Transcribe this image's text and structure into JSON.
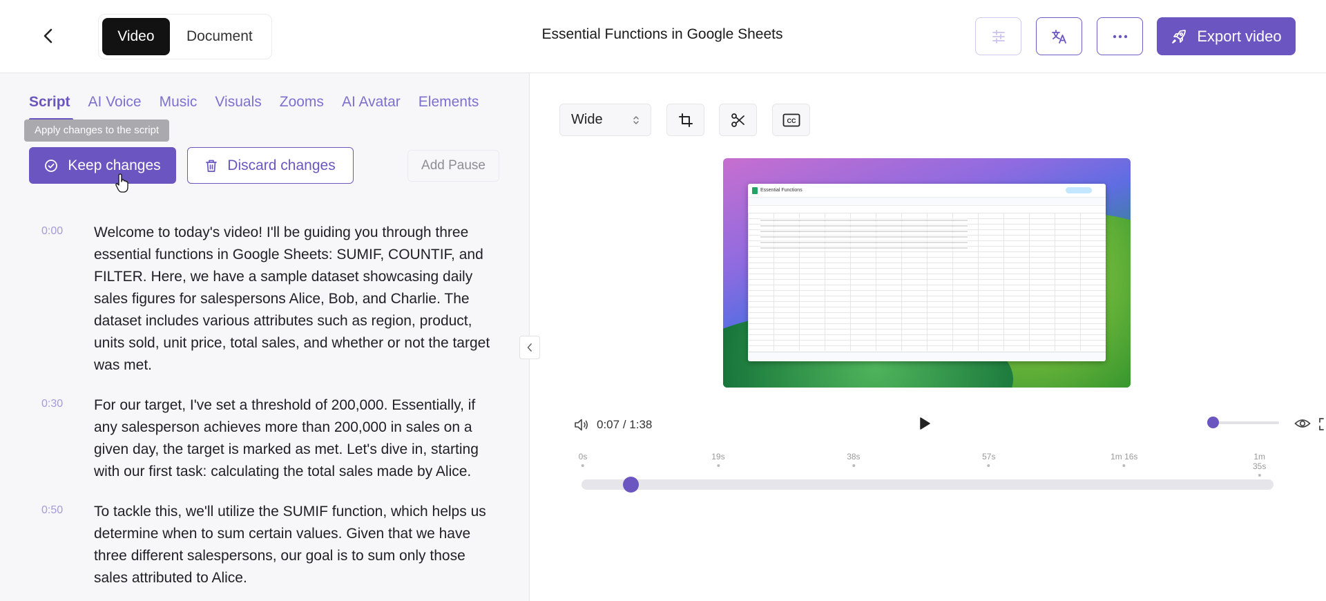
{
  "header": {
    "title": "Essential Functions in Google Sheets",
    "mode_tabs": [
      {
        "label": "Video",
        "active": true
      },
      {
        "label": "Document",
        "active": false
      }
    ],
    "export_label": "Export video",
    "icons": [
      "back-chevron-icon",
      "sliders-icon",
      "translate-icon",
      "more-icon",
      "rocket-icon"
    ]
  },
  "left": {
    "tabs": [
      {
        "label": "Script",
        "active": true
      },
      {
        "label": "AI Voice"
      },
      {
        "label": "Music"
      },
      {
        "label": "Visuals"
      },
      {
        "label": "Zooms"
      },
      {
        "label": "AI Avatar"
      },
      {
        "label": "Elements"
      }
    ],
    "tooltip": "Apply changes to the script",
    "keep_label": "Keep changes",
    "discard_label": "Discard changes",
    "pause_label": "Add Pause",
    "script": [
      {
        "time": "0:00",
        "text": "Welcome to today's video! I'll be guiding you through three essential functions in Google Sheets: SUMIF, COUNTIF, and FILTER. Here, we have a sample dataset showcasing daily sales figures for salespersons Alice, Bob, and Charlie. The dataset includes various attributes such as region, product, units sold, unit price, total sales, and whether or not the target was met."
      },
      {
        "time": "0:30",
        "text": "For our target, I've set a threshold of 200,000. Essentially, if any salesperson achieves more than 200,000 in sales on a given day, the target is marked as met. Let's dive in, starting with our first task: calculating the total sales made by Alice."
      },
      {
        "time": "0:50",
        "text": "To tackle this, we'll utilize the SUMIF function, which helps us determine when to sum certain values. Given that we have three different salespersons, our goal is to sum only those sales attributed to Alice."
      }
    ]
  },
  "preview": {
    "aspect": "Wide",
    "sheet_title": "Essential Functions",
    "current_time": "0:07",
    "time_separator": "/",
    "duration": "1:38",
    "progress": 0.071,
    "volume": 0.0,
    "timeline_ticks": [
      "0s",
      "19s",
      "38s",
      "57s",
      "1m 16s",
      "1m 35s"
    ]
  },
  "colors": {
    "accent": "#6b55c0",
    "accent_light": "#a49ad8"
  }
}
